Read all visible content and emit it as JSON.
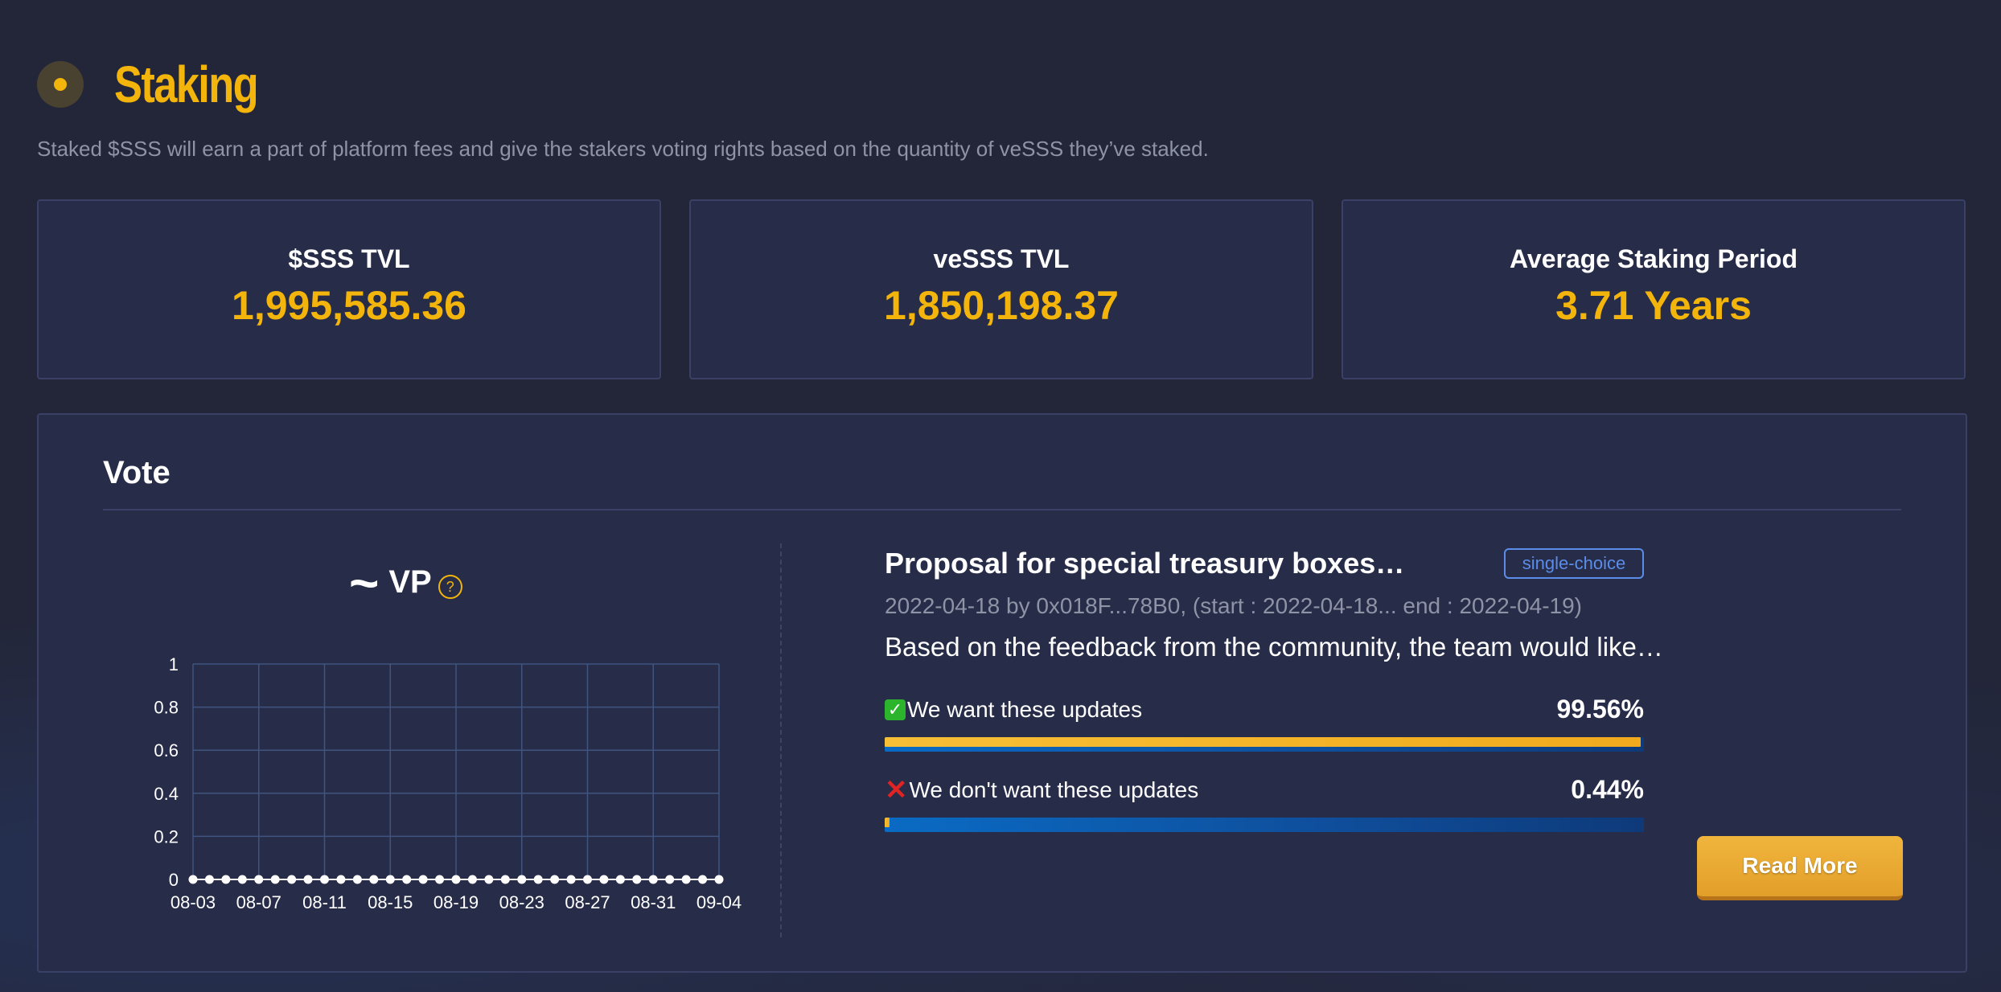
{
  "header": {
    "title": "Staking",
    "subtitle": "Staked $SSS will earn a part of platform fees and give the stakers voting rights based on the quantity of veSSS they’ve staked."
  },
  "stats": [
    {
      "label": "$SSS TVL",
      "value": "1,995,585.36"
    },
    {
      "label": "veSSS TVL",
      "value": "1,850,198.37"
    },
    {
      "label": "Average Staking Period",
      "value": "3.71 Years"
    }
  ],
  "vote": {
    "title": "Vote",
    "vp_symbol": "~",
    "vp_label": "VP",
    "help_glyph": "?",
    "proposal": {
      "title": "Proposal for special treasury boxes…",
      "badge": "single-choice",
      "meta": "2022-04-18 by 0x018F...78B0, (start : 2022-04-18... end : 2022-04-19)",
      "description": "Based on the feedback from the community, the team would like…",
      "options": [
        {
          "icon": "check-icon",
          "glyph": "✓",
          "label": "We want these updates",
          "percent": "99.56%",
          "fraction": 0.9956
        },
        {
          "icon": "cross-icon",
          "glyph": "✕",
          "label": "We don't want these updates",
          "percent": "0.44%",
          "fraction": 0.0044
        }
      ]
    },
    "read_more_label": "Read More"
  },
  "colors": {
    "accent": "#f3b50c",
    "background": "#232638",
    "panel": "#272c48",
    "bar_track": "#0a6bc4",
    "bar_fill": "#f7bf36"
  },
  "chart_data": {
    "type": "line",
    "title": "VP",
    "xlabel": "",
    "ylabel": "",
    "ylim": [
      0,
      1
    ],
    "yticks": [
      "0",
      "0.2",
      "0.4",
      "0.6",
      "0.8",
      "1"
    ],
    "xtick_labels": [
      "08-03",
      "08-07",
      "08-11",
      "08-15",
      "08-19",
      "08-23",
      "08-27",
      "08-31",
      "09-04"
    ],
    "x": [
      "08-03",
      "08-04",
      "08-05",
      "08-06",
      "08-07",
      "08-08",
      "08-09",
      "08-10",
      "08-11",
      "08-12",
      "08-13",
      "08-14",
      "08-15",
      "08-16",
      "08-17",
      "08-18",
      "08-19",
      "08-20",
      "08-21",
      "08-22",
      "08-23",
      "08-24",
      "08-25",
      "08-26",
      "08-27",
      "08-28",
      "08-29",
      "08-30",
      "08-31",
      "09-01",
      "09-02",
      "09-03",
      "09-04"
    ],
    "series": [
      {
        "values": [
          0,
          0,
          0,
          0,
          0,
          0,
          0,
          0,
          0,
          0,
          0,
          0,
          0,
          0,
          0,
          0,
          0,
          0,
          0,
          0,
          0,
          0,
          0,
          0,
          0,
          0,
          0,
          0,
          0,
          0,
          0,
          0,
          0
        ]
      }
    ],
    "grid": true
  }
}
